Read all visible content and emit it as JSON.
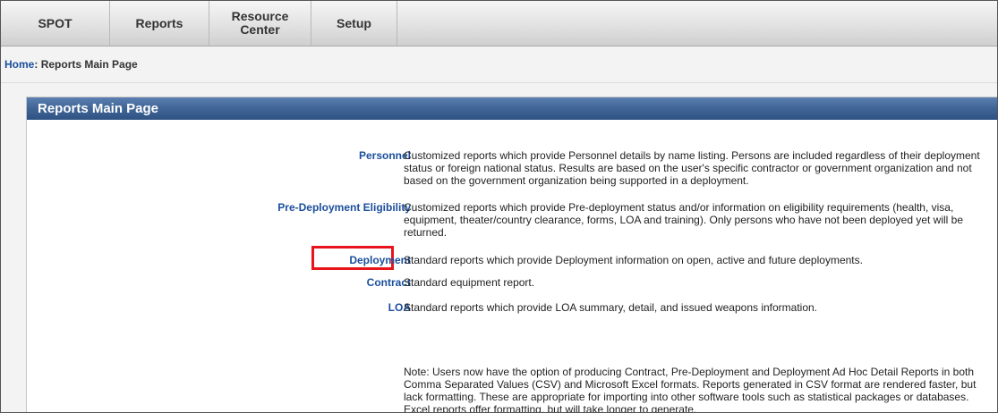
{
  "nav": {
    "tabs": [
      {
        "label": "SPOT"
      },
      {
        "label": "Reports"
      },
      {
        "label": "Resource Center"
      },
      {
        "label": "Setup"
      }
    ]
  },
  "breadcrumb": {
    "home": "Home",
    "separator": ":",
    "current": "Reports Main Page"
  },
  "panel": {
    "title": "Reports Main Page"
  },
  "reports": [
    {
      "label": "Personnel",
      "description": "Customized reports which provide Personnel details by name listing. Persons are included regardless of their deployment status or foreign national status. Results are based on the user's specific contractor or government organization and not based on the government organization being supported in a deployment."
    },
    {
      "label": "Pre-Deployment Eligibility",
      "description": "Customized reports which provide Pre-deployment status and/or information on eligibility requirements (health, visa, equipment, theater/country clearance, forms, LOA and training). Only persons who have not been deployed yet will be returned."
    },
    {
      "label": "Deployment",
      "description": "Standard reports which provide Deployment information on open, active and future deployments.",
      "highlighted": true
    },
    {
      "label": "Contract",
      "description": "Standard equipment report."
    },
    {
      "label": "LOA",
      "description": "Standard reports which provide LOA summary, detail, and issued weapons information."
    }
  ],
  "note": "Note: Users now have the option of producing Contract, Pre-Deployment and Deployment Ad Hoc Detail Reports in both Comma Separated Values (CSV) and Microsoft Excel formats. Reports generated in CSV format are rendered faster, but lack formatting. These are appropriate for importing into other software tools such as statistical packages or databases. Excel reports offer formatting, but will take longer to generate.",
  "colors": {
    "link": "#1a4e9c",
    "panel_header": "#3f6496",
    "highlight": "#e8141c"
  }
}
